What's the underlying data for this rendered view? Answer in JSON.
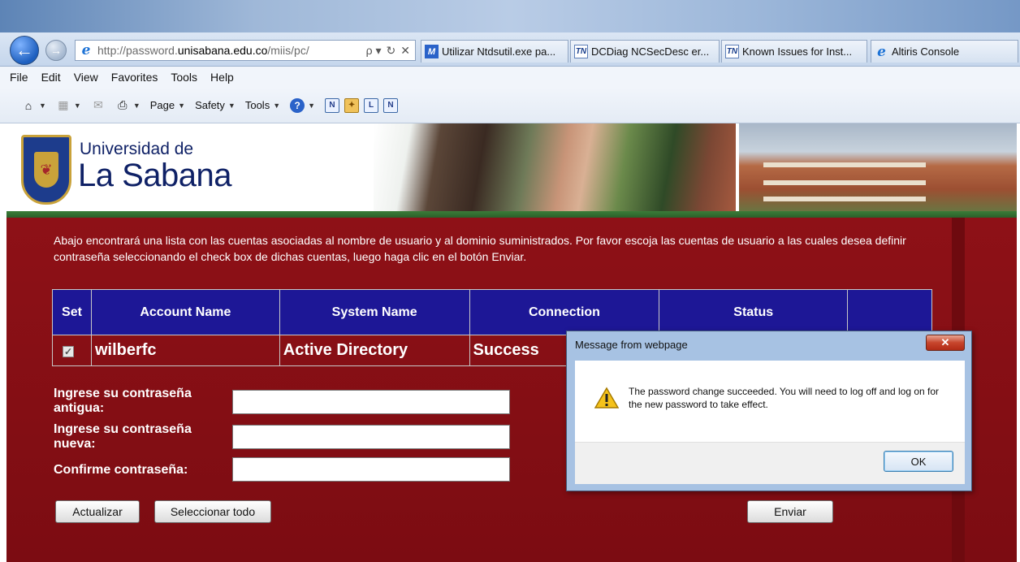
{
  "browser": {
    "address": {
      "url_prefix": "http://password.",
      "url_domain": "unisabana.edu.co",
      "url_suffix": "/miis/pc/",
      "search_glyph": "ρ ▾",
      "refresh_glyph": "↻",
      "stop_glyph": "✕"
    },
    "tabs": [
      {
        "label": "Utilizar Ntdsutil.exe pa...",
        "icon": "M"
      },
      {
        "label": "DCDiag NCSecDesc er...",
        "icon": "TN"
      },
      {
        "label": "Known Issues for Inst...",
        "icon": "TN"
      },
      {
        "label": "Altiris Console",
        "icon": "e"
      }
    ],
    "menu": [
      "File",
      "Edit",
      "View",
      "Favorites",
      "Tools",
      "Help"
    ],
    "commands": {
      "page": "Page",
      "safety": "Safety",
      "tools": "Tools"
    }
  },
  "banner": {
    "logo_line1": "Universidad de",
    "logo_line2": "La Sabana"
  },
  "content": {
    "intro": "Abajo encontrará una lista con las cuentas asociadas al nombre de usuario y al dominio suministrados. Por favor escoja las cuentas de usuario a las cuales desea definir contraseña seleccionando el check box de dichas cuentas, luego haga clic en el botón Enviar.",
    "table": {
      "headers": [
        "Set",
        "Account Name",
        "System Name",
        "Connection",
        "Status",
        ""
      ],
      "row": {
        "set_checked": true,
        "account": "wilberfc",
        "system": "Active Directory",
        "connection": "Success",
        "status": ""
      }
    },
    "form": {
      "old_password_label_1": "Ingrese su contraseña",
      "old_password_label_2": "antigua:",
      "new_password_label_1": "Ingrese su contraseña",
      "new_password_label_2": "nueva:",
      "confirm_label": "Confirme contraseña:"
    },
    "buttons": {
      "update": "Actualizar",
      "select_all": "Seleccionar todo",
      "send": "Enviar"
    }
  },
  "dialog": {
    "title": "Message from webpage",
    "message": "The password change succeeded. You will need to log off and log on for the new password to take effect.",
    "ok": "OK",
    "close": "✕"
  }
}
